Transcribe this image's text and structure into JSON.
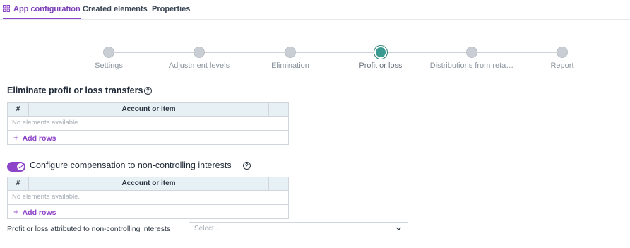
{
  "tabs": [
    {
      "label": "App configuration",
      "active": true,
      "icon": "grid-icon"
    },
    {
      "label": "Created elements",
      "active": false
    },
    {
      "label": "Properties",
      "active": false
    }
  ],
  "stepper": {
    "current_index": 3,
    "steps": [
      {
        "label": "Settings"
      },
      {
        "label": "Adjustment levels"
      },
      {
        "label": "Elimination"
      },
      {
        "label": "Profit or loss"
      },
      {
        "label": "Distributions from reta…"
      },
      {
        "label": "Report"
      }
    ]
  },
  "section1": {
    "title": "Eliminate profit or loss transfers",
    "help_icon": "question-circle-icon",
    "table": {
      "columns": [
        "#",
        "Account or item"
      ],
      "empty_text": "No elements available.",
      "add_label": "Add rows"
    }
  },
  "section2": {
    "toggle_on": true,
    "title": "Configure compensation to non-controlling interests",
    "help_icon": "question-circle-icon",
    "table": {
      "columns": [
        "#",
        "Account or item"
      ],
      "empty_text": "No elements available.",
      "add_label": "Add rows"
    }
  },
  "field": {
    "label": "Profit or loss attributed to non-controlling interests",
    "placeholder": "Select..."
  },
  "colors": {
    "accent": "#8e44c8",
    "current_step": "#3b9a91",
    "table_header": "#e7f1f5"
  }
}
